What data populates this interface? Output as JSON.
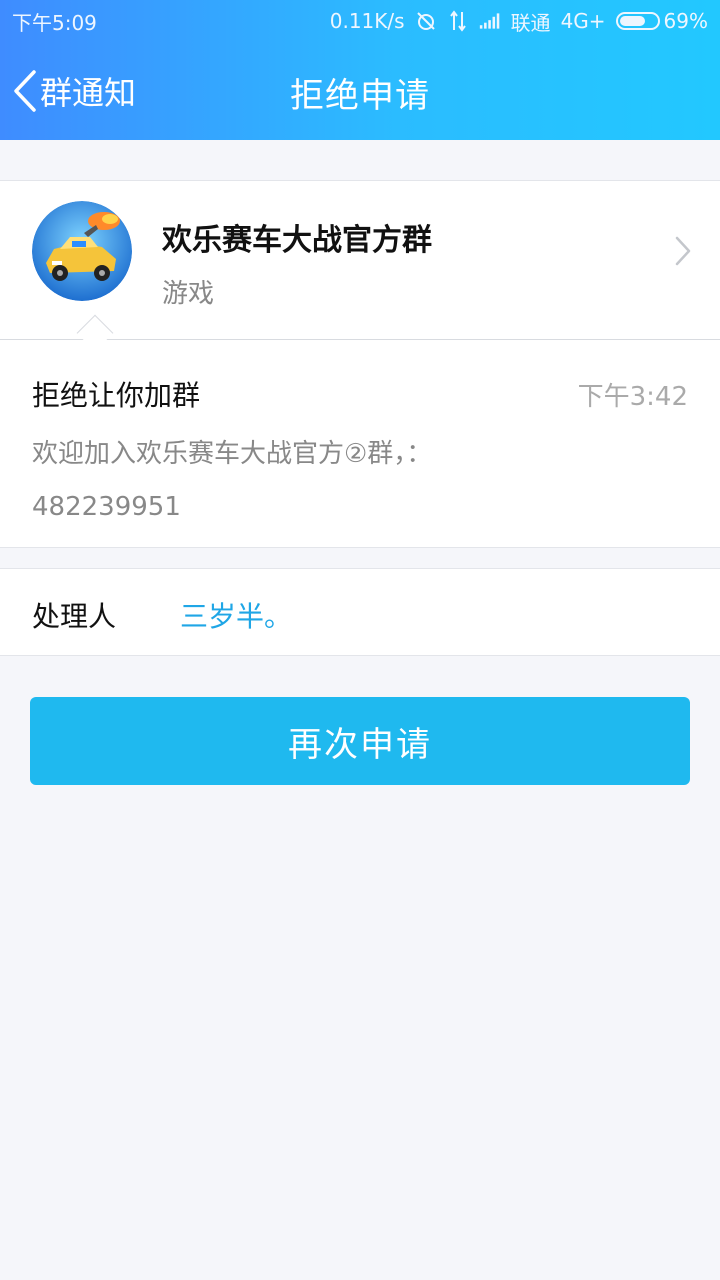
{
  "status_bar": {
    "time": "下午5:09",
    "net_speed": "0.11K/s",
    "carrier": "联通",
    "network_type": "4G+",
    "battery_percent": "69%",
    "battery_level": 0.69
  },
  "nav": {
    "back_label": "群通知",
    "title": "拒绝申请"
  },
  "group": {
    "name": "欢乐赛车大战官方群",
    "category": "游戏",
    "avatar_icon": "race-car-game-avatar"
  },
  "message": {
    "title": "拒绝让你加群",
    "time": "下午3:42",
    "body_line1": "欢迎加入欢乐赛车大战官方②群，：",
    "body_line2": "482239951"
  },
  "handler": {
    "label": "处理人",
    "name": "三岁半。"
  },
  "actions": {
    "reapply_label": "再次申请"
  },
  "colors": {
    "accent": "#1fb9ef",
    "link": "#1fa6e6",
    "header_start": "#3f8cff",
    "header_end": "#22c8ff"
  }
}
